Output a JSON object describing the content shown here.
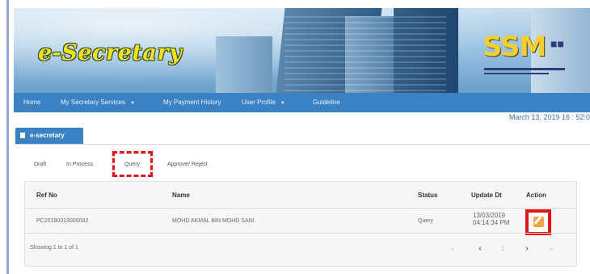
{
  "header": {
    "app_logo": "e-Secretary",
    "brand_logo": "SSM",
    "brand_tagline": "SURUHANJAYA SYARIKAT MALAYSIA"
  },
  "nav": {
    "items": [
      {
        "label": "Home"
      },
      {
        "label": "My Secretary Services"
      },
      {
        "label": "My Payment History"
      },
      {
        "label": "User Profile"
      },
      {
        "label": "Guideline"
      }
    ]
  },
  "datetime": "March 13, 2019 16 : 52:0",
  "panel": {
    "tab_label": "e-secretary"
  },
  "status_tabs": [
    {
      "label": "Draft"
    },
    {
      "label": "In Process"
    },
    {
      "label": "Query"
    },
    {
      "label": "Approve/ Reject"
    }
  ],
  "table": {
    "columns": [
      "Ref No",
      "Name",
      "Status",
      "Update Dt",
      "Action"
    ],
    "rows": [
      {
        "ref_no": "PC20190313000082",
        "name": "MOHD AKMAL BIN MOHD SANI",
        "status": "Query",
        "update_date": "13/03/2019",
        "update_time": "04:14:34 PM"
      }
    ],
    "showing_text": "Showing 1 to 1 of 1"
  },
  "pagination": {
    "first": "«",
    "prev": "‹",
    "current": "1",
    "next": "›",
    "last": "»"
  },
  "colors": {
    "nav_bg": "#3b82c4",
    "highlight": "#e01414",
    "edit_icon": "#f2a245"
  }
}
